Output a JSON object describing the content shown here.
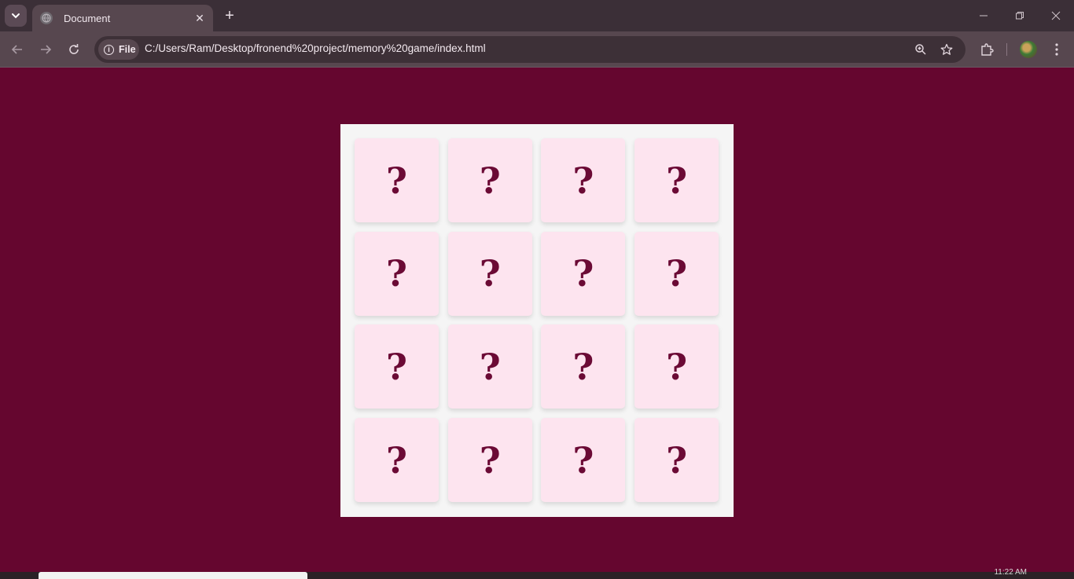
{
  "browser": {
    "tab": {
      "title": "Document",
      "favicon": "globe-icon"
    },
    "new_tab_label": "+",
    "address": {
      "chip_label": "File",
      "url": "C:/Users/Ram/Desktop/fronend%20project/memory%20game/index.html"
    },
    "icons": [
      "tab-search-icon",
      "back-icon",
      "forward-icon",
      "reload-icon",
      "info-icon",
      "zoom-icon",
      "star-icon",
      "extensions-icon",
      "profile-avatar",
      "menu-icon",
      "minimize-icon",
      "restore-icon",
      "close-icon"
    ]
  },
  "game": {
    "rows": 4,
    "columns": 4,
    "cards": [
      "?",
      "?",
      "?",
      "?",
      "?",
      "?",
      "?",
      "?",
      "?",
      "?",
      "?",
      "?",
      "?",
      "?",
      "?",
      "?"
    ]
  },
  "taskbar": {
    "clock": "11:22 AM"
  },
  "colors": {
    "page_background": "#65062f",
    "board_background": "#f5f5f5",
    "card_background": "#fde4ef",
    "card_symbol": "#6b0a35",
    "tabstrip": "#3b2f37",
    "toolbar": "#57474f"
  }
}
